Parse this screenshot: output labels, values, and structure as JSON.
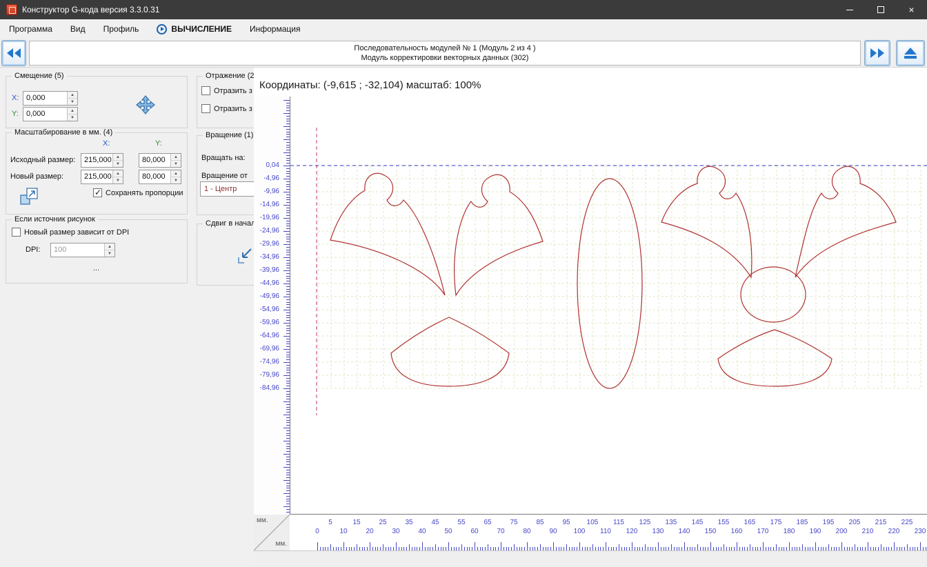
{
  "colors": {
    "drawing": "#b03030",
    "grid": "#dfe7c3",
    "axis-x": "#3333cc",
    "axis-y": "#c03377",
    "ruler": "#4646c8",
    "accent": "#2277cc"
  },
  "window": {
    "title": "Конструктор G-кода версия 3.3.0.31"
  },
  "menu": {
    "items": [
      {
        "label": "Программа"
      },
      {
        "label": "Вид"
      },
      {
        "label": "Профиль"
      },
      {
        "label": "ВЫЧИСЛЕНИЕ"
      },
      {
        "label": "Информация"
      }
    ]
  },
  "toolbar": {
    "line1": "Последовательность модулей № 1 (Модуль 2 из 4 )",
    "line2": "Модуль корректировки векторных данных (302)"
  },
  "panels": {
    "offset": {
      "title": "Смещение (5)",
      "x_label": "X:",
      "x_value": "0,000",
      "y_label": "Y:",
      "y_value": "0,000"
    },
    "scale": {
      "title": "Масштабирование в мм. (4)",
      "col_x": "X:",
      "col_y": "Y:",
      "row1_label": "Исходный размер:",
      "row1_x": "215,000",
      "row1_y": "80,000",
      "row2_label": "Новый размер:",
      "row2_x": "215,000",
      "row2_y": "80,000",
      "keep_label": "Сохранять пропорции",
      "keep_checked": true
    },
    "source": {
      "title": "Если источник рисунок",
      "dpi_check_label": "Новый размер зависит от DPI",
      "dpi_checked": false,
      "dpi_label": "DPI:",
      "dpi_value": "100",
      "more": "..."
    },
    "mirror": {
      "title": "Отражение (2)",
      "check1": "Отразить з",
      "check1_checked": false,
      "check2": "Отразить з",
      "check2_checked": false
    },
    "rotation": {
      "title": "Вращение (1)",
      "rotate_label": "Вращать на:",
      "from_label": "Вращение от",
      "selected": "1 - Центр"
    },
    "shift": {
      "title": "Сдвиг в начал"
    }
  },
  "canvas": {
    "coords": "Координаты: (-9,615 ; -32,104) масштаб: 100%",
    "unit_v": "мм.",
    "unit_h": "мм.",
    "v_labels": [
      "0,04",
      "-4,96",
      "-9,96",
      "-14,96",
      "-19,96",
      "-24,96",
      "-29,96",
      "-34,96",
      "-39,96",
      "-44,96",
      "-49,96",
      "-54,96",
      "-59,96",
      "-64,96",
      "-69,96",
      "-74,96",
      "-79,96",
      "-84,96"
    ],
    "h_labels": [
      0,
      5,
      10,
      15,
      20,
      25,
      30,
      35,
      40,
      45,
      50,
      55,
      60,
      65,
      70,
      75,
      80,
      85,
      90,
      95,
      100,
      105,
      110,
      115,
      120,
      125,
      130,
      135,
      140,
      145,
      150,
      155,
      160,
      165,
      170,
      175,
      180,
      185,
      190,
      195,
      200,
      205,
      210,
      215,
      220,
      225,
      230
    ]
  }
}
